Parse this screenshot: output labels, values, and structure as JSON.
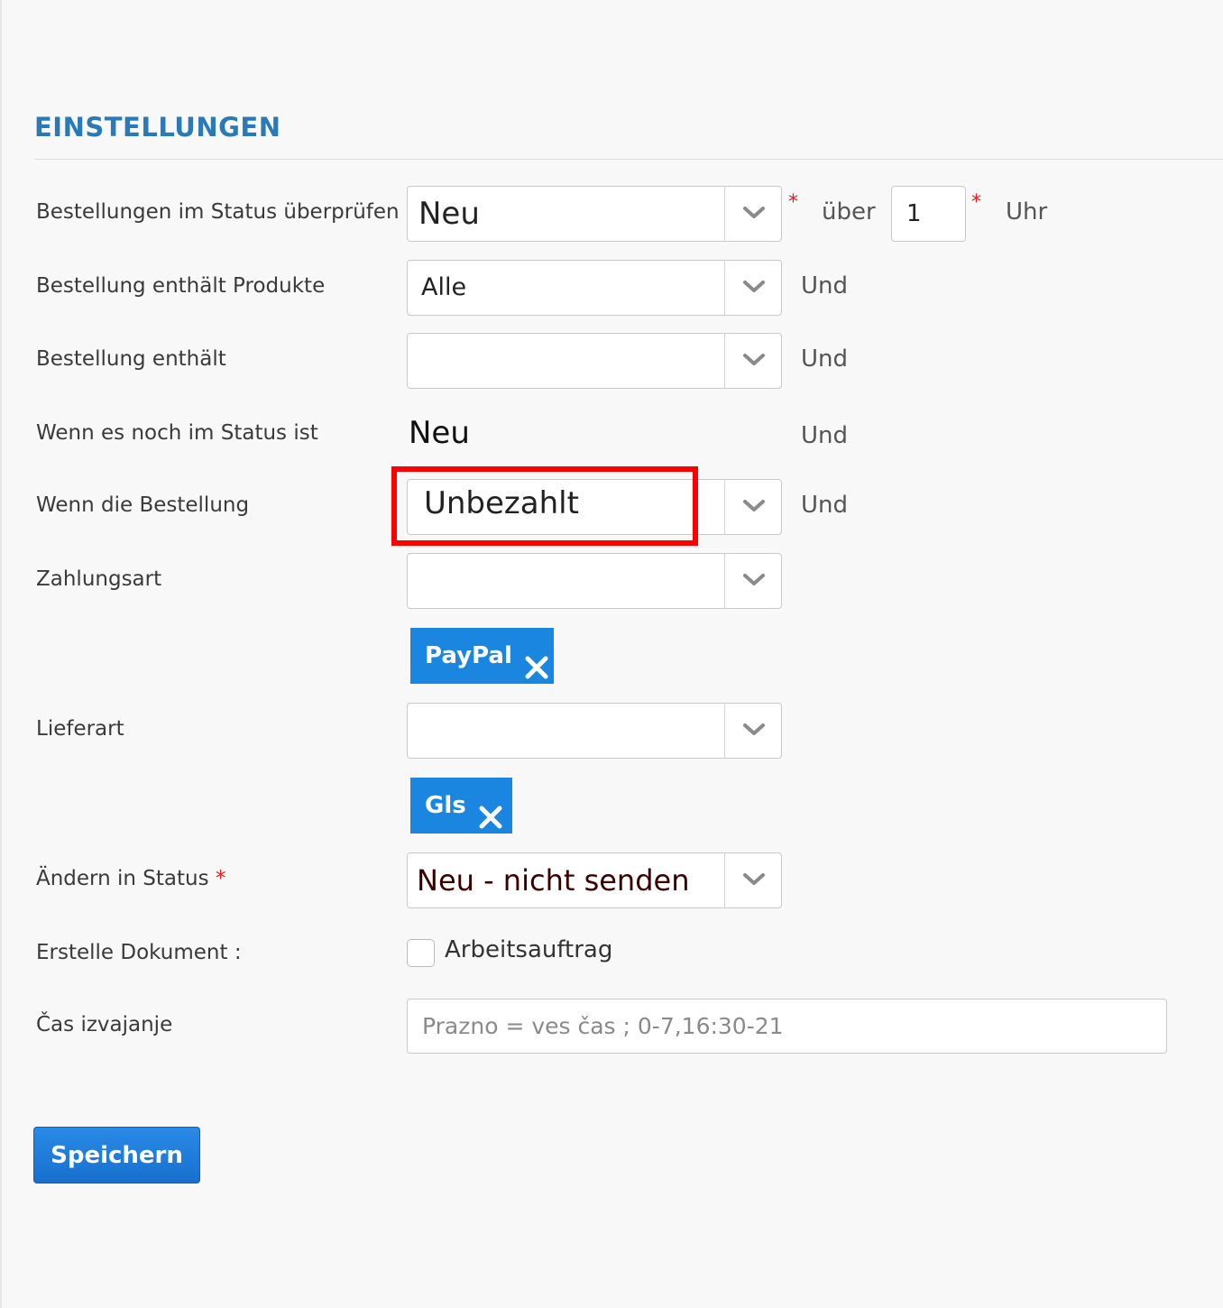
{
  "section": {
    "title": "EINSTELLUNGEN"
  },
  "rows": {
    "status_check": {
      "label": "Bestellungen im Status überprüfen",
      "value": "Neu",
      "star": "*",
      "over_text": "über",
      "hours_value": "1",
      "hours_star": "*",
      "hours_unit": "Uhr"
    },
    "contains_products": {
      "label": "Bestellung enthält Produkte",
      "value": "Alle",
      "conj": "Und"
    },
    "contains": {
      "label": "Bestellung enthält",
      "value": "",
      "conj": "Und"
    },
    "still_in_status": {
      "label": "Wenn es noch im Status ist",
      "value": "Neu",
      "conj": "Und"
    },
    "if_order": {
      "label": "Wenn die Bestellung",
      "value": "Unbezahlt",
      "conj": "Und"
    },
    "payment": {
      "label": "Zahlungsart",
      "value": "",
      "tag": "PayPal"
    },
    "delivery": {
      "label": "Lieferart",
      "value": "",
      "tag": "Gls"
    },
    "change_status": {
      "label": "Ändern in Status",
      "required": "*",
      "value": "Neu - nicht senden"
    },
    "create_doc": {
      "label": "Erstelle Dokument :",
      "checkbox_label": "Arbeitsauftrag"
    },
    "exec_time": {
      "label": "Čas izvajanje",
      "placeholder": "Prazno = ves čas ; 0-7,16:30-21"
    }
  },
  "actions": {
    "save_label": "Speichern"
  },
  "colors": {
    "accent": "#1b86e0",
    "title": "#2a7ab8",
    "required": "#e02020",
    "highlight": "#ff0000"
  }
}
